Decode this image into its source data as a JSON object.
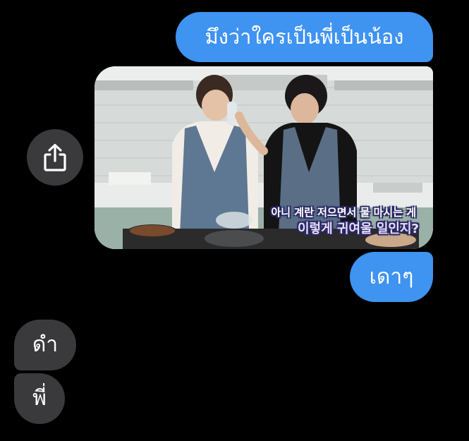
{
  "messages": [
    {
      "id": "m1",
      "direction": "outgoing",
      "type": "text",
      "text": "มึงว่าใครเป็นพี่เป็นน้อง"
    },
    {
      "id": "m2",
      "direction": "outgoing",
      "type": "image",
      "caption_lines": [
        "아니 계란 저으면서 물 마시는 게",
        "이렇게 귀여울 일인지?"
      ]
    },
    {
      "id": "m3",
      "direction": "outgoing",
      "type": "text",
      "text": "เดาๆ"
    },
    {
      "id": "m4",
      "direction": "incoming",
      "type": "text",
      "text": "ดำ"
    },
    {
      "id": "m5",
      "direction": "incoming",
      "type": "text",
      "text": "พี่"
    }
  ],
  "share_button": {
    "icon": "share-icon"
  },
  "colors": {
    "background": "#000000",
    "outgoing_bubble": "#3f93f1",
    "incoming_bubble": "#3a3a3c",
    "text": "#ffffff"
  }
}
